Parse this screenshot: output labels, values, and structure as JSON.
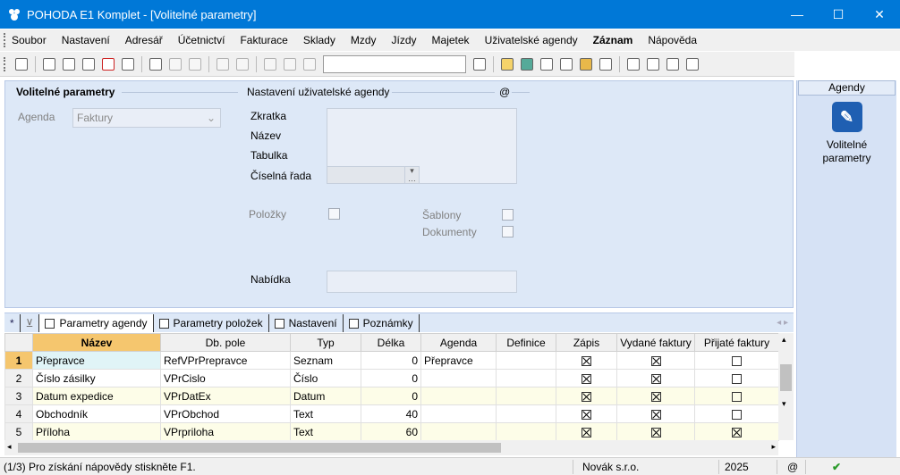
{
  "window": {
    "title": "POHODA E1 Komplet - [Volitelné parametry]",
    "minimize_glyph": "—",
    "maximize_glyph": "☐",
    "close_glyph": "✕"
  },
  "menu": [
    "Soubor",
    "Nastavení",
    "Adresář",
    "Účetnictví",
    "Fakturace",
    "Sklady",
    "Mzdy",
    "Jízdy",
    "Majetek",
    "Uživatelské agendy",
    "Záznam",
    "Nápověda"
  ],
  "toolbar": {
    "combo_value": ""
  },
  "form": {
    "section1_title": "Volitelné parametry",
    "agenda_label": "Agenda",
    "agenda_value": "Faktury",
    "section2_title": "Nastavení uživatelské agendy",
    "section2_marker": "@",
    "zkratka_label": "Zkratka",
    "nazev_label": "Název",
    "tabulka_label": "Tabulka",
    "ciselna_rada_label": "Číselná řada",
    "polozky_label": "Položky",
    "sablony_label": "Šablony",
    "dokumenty_label": "Dokumenty",
    "nabidka_label": "Nabídka"
  },
  "side": {
    "header": "Agendy",
    "item_label_1": "Volitelné",
    "item_label_2": "parametry"
  },
  "tabs": {
    "star": "*",
    "items": [
      "Parametry agendy",
      "Parametry položek",
      "Nastavení",
      "Poznámky"
    ]
  },
  "grid": {
    "columns": [
      "Název",
      "Db. pole",
      "Typ",
      "Délka",
      "Agenda",
      "Definice",
      "Zápis",
      "Vydané faktury",
      "Přijaté faktury"
    ],
    "rows": [
      {
        "n": "1",
        "name": "Přepravce",
        "db": "RefVPrPrepravce",
        "typ": "Seznam",
        "delka": "0",
        "agenda": "Přepravce",
        "definice": "",
        "zapis": true,
        "vydane": true,
        "prijate": false
      },
      {
        "n": "2",
        "name": "Číslo zásilky",
        "db": "VPrCislo",
        "typ": "Číslo",
        "delka": "0",
        "agenda": "",
        "definice": "",
        "zapis": true,
        "vydane": true,
        "prijate": false
      },
      {
        "n": "3",
        "name": "Datum expedice",
        "db": "VPrDatEx",
        "typ": "Datum",
        "delka": "0",
        "agenda": "",
        "definice": "",
        "zapis": true,
        "vydane": true,
        "prijate": false
      },
      {
        "n": "4",
        "name": "Obchodník",
        "db": "VPrObchod",
        "typ": "Text",
        "delka": "40",
        "agenda": "",
        "definice": "",
        "zapis": true,
        "vydane": true,
        "prijate": false
      },
      {
        "n": "5",
        "name": "Příloha",
        "db": "VPrpriloha",
        "typ": "Text",
        "delka": "60",
        "agenda": "",
        "definice": "",
        "zapis": true,
        "vydane": true,
        "prijate": true
      }
    ]
  },
  "status": {
    "help": "(1/3) Pro získání nápovědy stiskněte F1.",
    "company": "Novák s.r.o.",
    "year": "2025",
    "at": "@"
  }
}
